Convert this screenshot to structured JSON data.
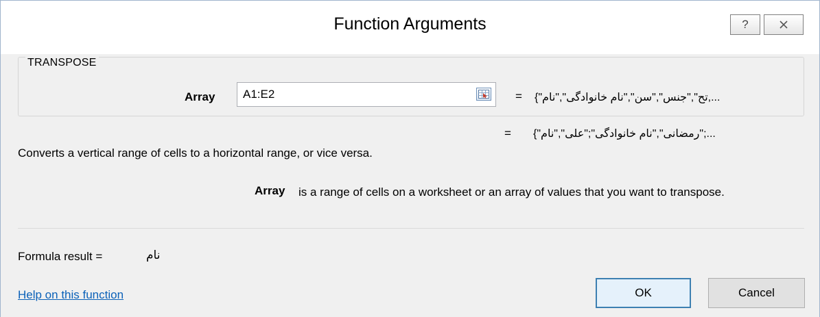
{
  "window": {
    "title": "Function Arguments",
    "help_label": "?",
    "close_icon": "close-icon"
  },
  "group": {
    "function_name": "TRANSPOSE",
    "argument": {
      "label": "Array",
      "value": "A1:E2",
      "ref_icon": "range-selector-icon",
      "preview": "{\"تح\",\"جنس\",\"سن\",\"نام خانوادگی\",\"نام,..."
    }
  },
  "result_preview": "{\"رمضانی\",\"نام خانوادگی\";\"علی\",\"نام\";...",
  "description": "Converts a vertical range of cells to a horizontal range, or vice versa.",
  "argument_help": {
    "label": "Array",
    "text": "is a range of cells on a worksheet or an array of values that you want to transpose."
  },
  "formula_result": {
    "label": "Formula result =",
    "value": "نام"
  },
  "help_link": "Help on this function",
  "buttons": {
    "ok": "OK",
    "cancel": "Cancel"
  },
  "equals": "="
}
